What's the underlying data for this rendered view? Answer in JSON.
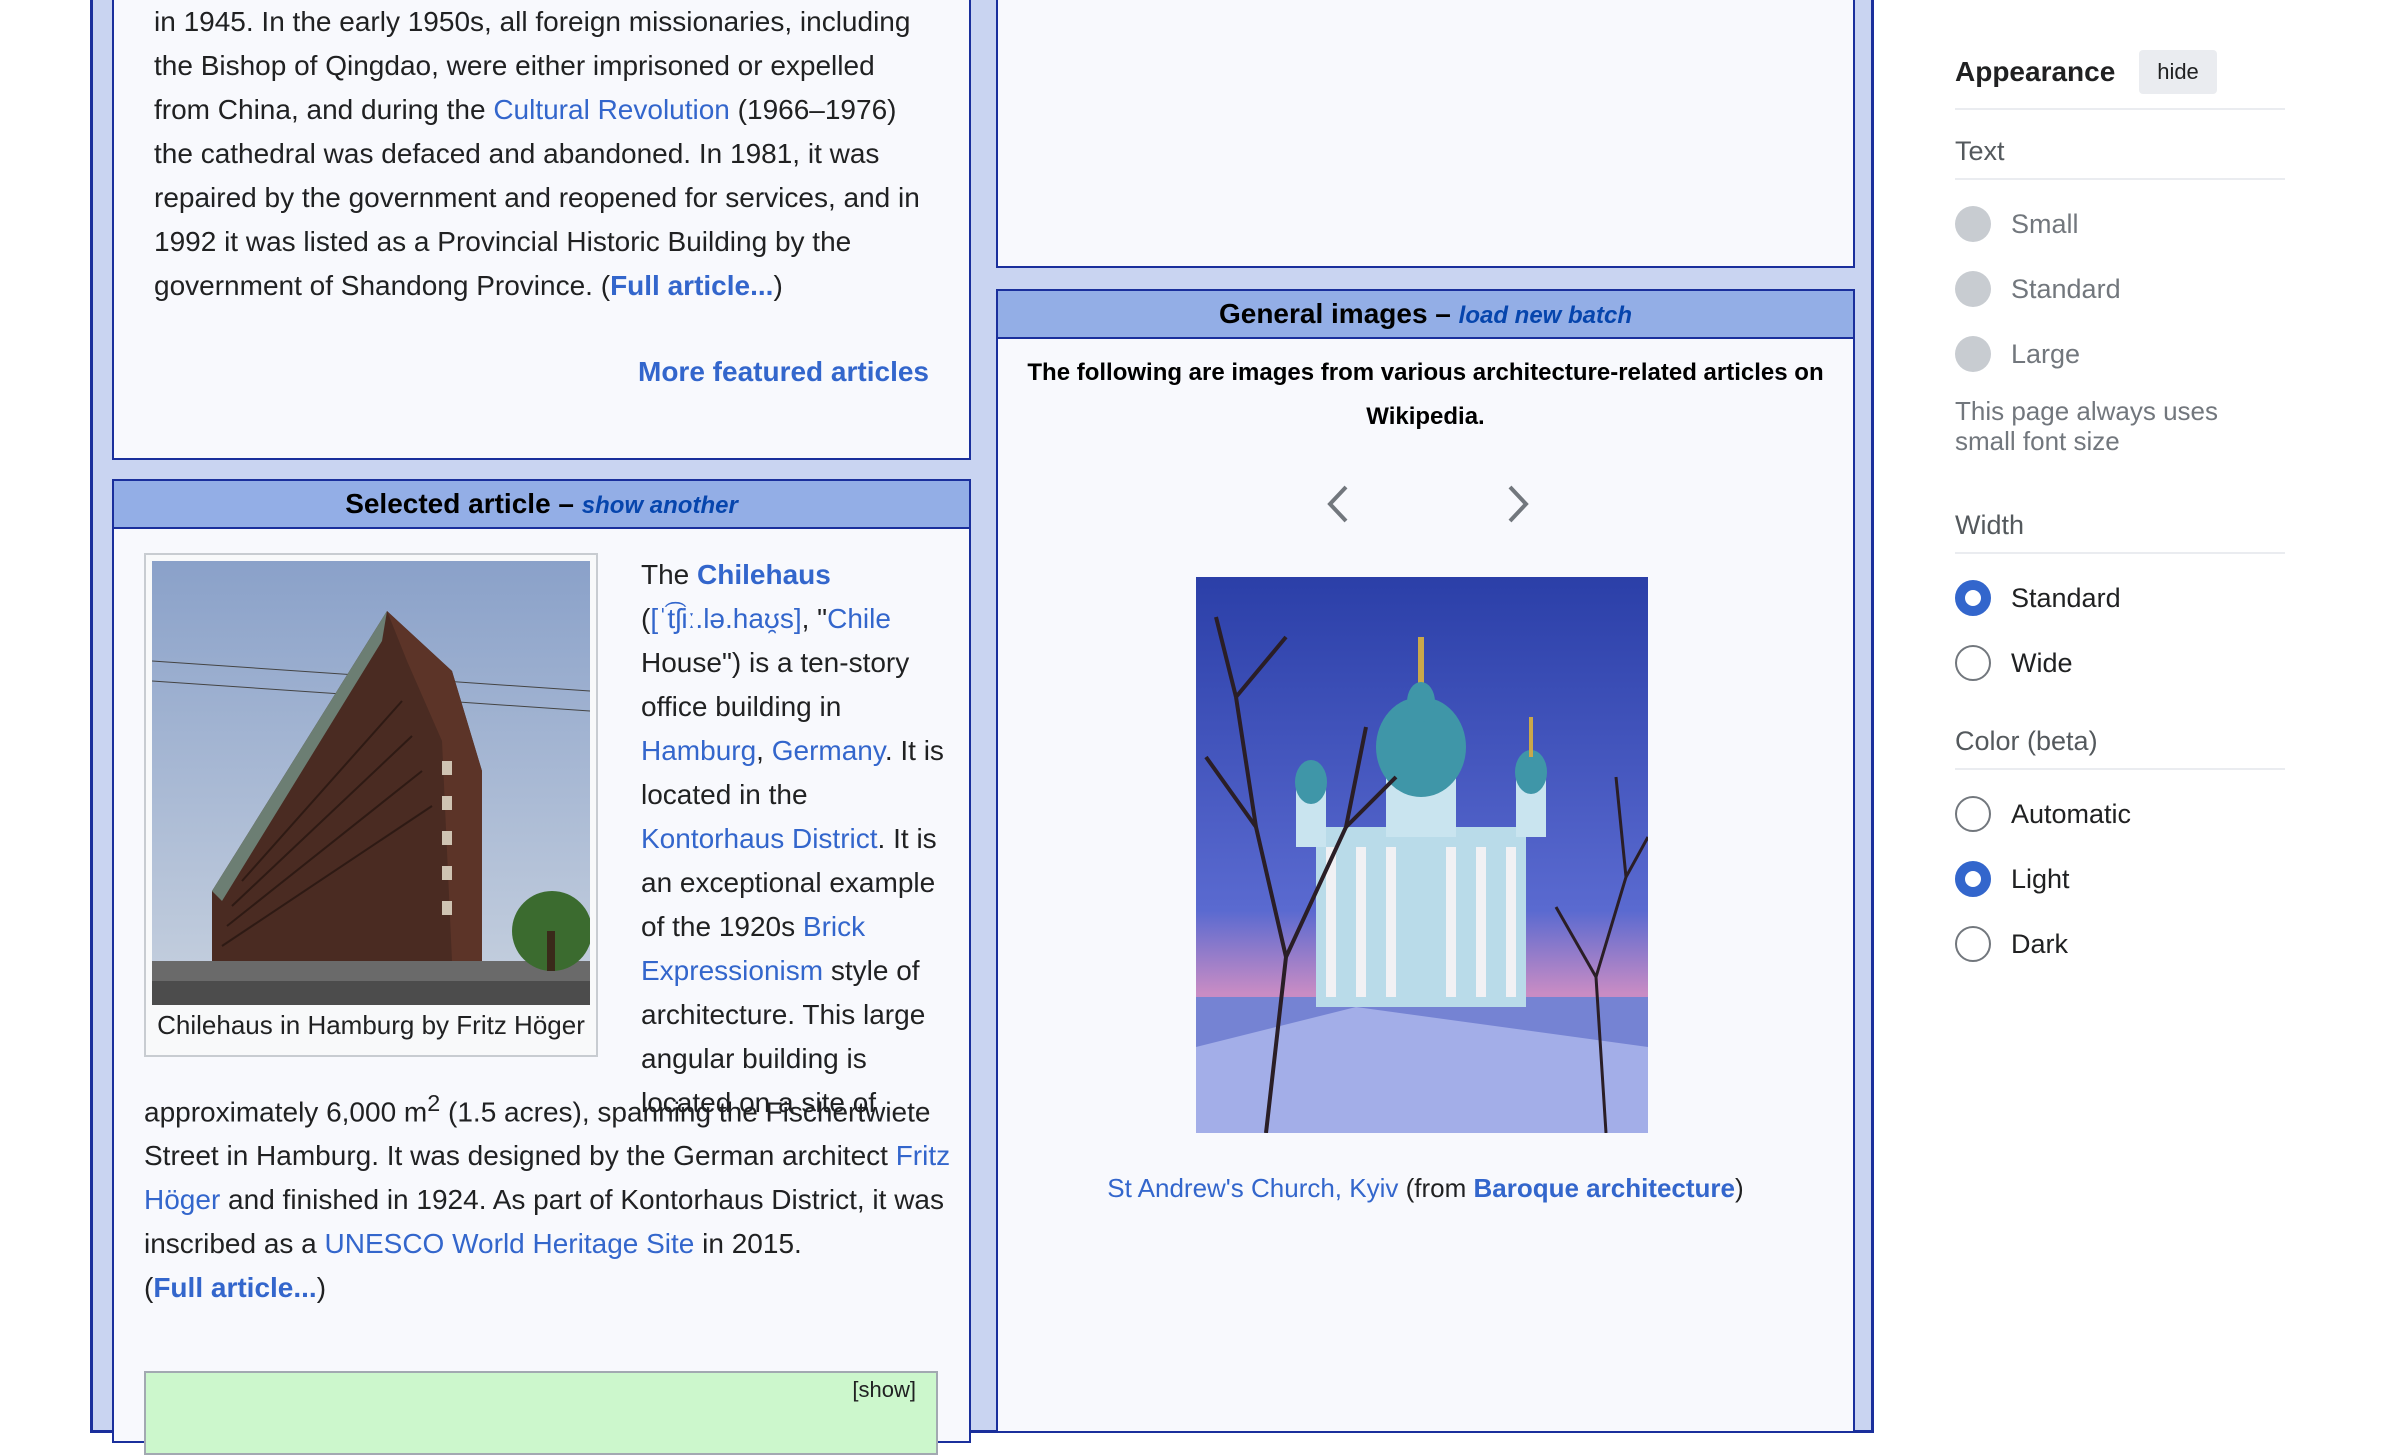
{
  "featured": {
    "lines": [
      "in 1945. In the early 1950s, all foreign missionaries, including",
      "the Bishop of Qingdao, were either imprisoned or expelled",
      "from China, and during the",
      "Cultural Revolution",
      "(1966–1976)",
      "the cathedral was defaced and abandoned. In 1981, it was",
      "repaired by the government and reopened for services, and in",
      "1992 it was listed as a Provincial Historic Building by the",
      "government of Shandong Province. (",
      "Full article...",
      ")"
    ],
    "more_link": "More featured articles"
  },
  "selected": {
    "header": "Selected article –",
    "header_link": "show another",
    "image_caption": "Chilehaus in Hamburg by Fritz Höger",
    "t": {
      "the": "The ",
      "chilehaus": "Chilehaus",
      "paren_open": "(",
      "ipa": "[ˈt͡ʃiː.lə.haʊ̯s]",
      "comma_quote": ", \"",
      "chile": "Chile",
      "house": "House\") is a ten-story office building in ",
      "hamburg": "Hamburg",
      "comma": ", ",
      "germany": "Germany",
      "located": ". It is located in the ",
      "kontorhaus": "Kontorhaus District",
      "exceptional": ". It is an exceptional example of the 1920s ",
      "brick": "Brick Expressionism",
      "style": " style of architecture. This large angular building is located on a site of",
      "approx": "approximately 6,000 m",
      "sup": "2",
      "spanning": " (1.5 acres), spanning the Fischertwiete Street in Hamburg. It was designed by the German architect ",
      "fritz": "Fritz Höger",
      "finished": " and finished in 1924. As part of Kontorhaus District, it was inscribed as a ",
      "unesco": "UNESCO World Heritage Site",
      "in2015": " in 2015.",
      "full_open": "(",
      "full": "Full article...",
      "full_close": ")"
    },
    "green_box_label": "[show]"
  },
  "general": {
    "header": "General images –",
    "header_link": "load new batch",
    "description": "The following are images from various architecture-related articles on Wikipedia.",
    "caption_link": "St Andrew's Church, Kyiv",
    "caption_mid": " (from ",
    "caption_bold": "Baroque architecture",
    "caption_end": ")"
  },
  "appearance": {
    "title": "Appearance",
    "hide_label": "hide",
    "text_label": "Text",
    "text_options": [
      "Small",
      "Standard",
      "Large"
    ],
    "font_note": "This page always uses small font size",
    "width_label": "Width",
    "width_options": [
      "Standard",
      "Wide"
    ],
    "width_selected": "Standard",
    "color_label": "Color (beta)",
    "color_options": [
      "Automatic",
      "Light",
      "Dark"
    ],
    "color_selected": "Light"
  },
  "colors": {
    "frame_bg": "#c9d4f1",
    "frame_border": "#1a2f9c",
    "header_bg": "#93aee6",
    "link": "#3366cc",
    "radio_checked": "#3366cc"
  }
}
